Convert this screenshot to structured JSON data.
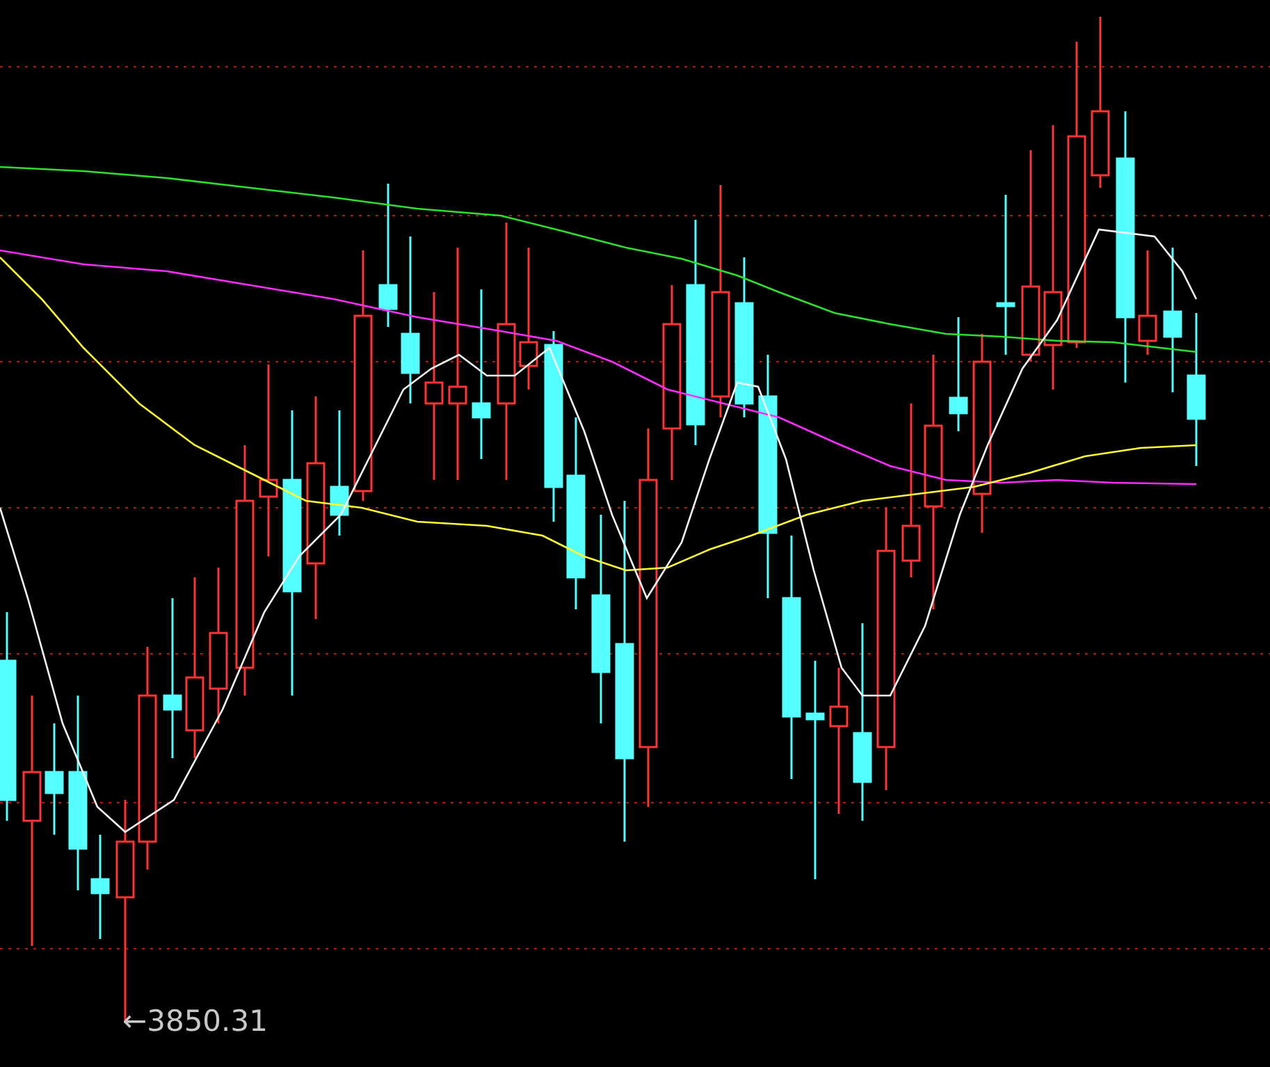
{
  "chart": {
    "low_marker": "←3850.31"
  }
}
